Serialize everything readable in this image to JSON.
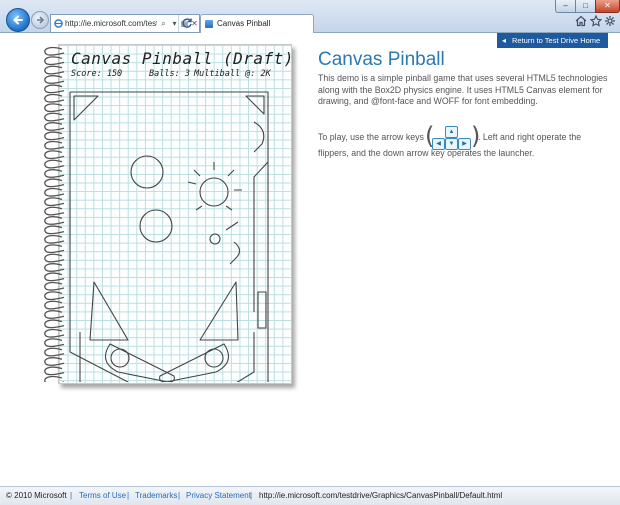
{
  "browser": {
    "address_url": "http://ie.microsoft.com/testdri",
    "tab_title": "Canvas Pinball",
    "colors": {
      "accent": "#1e5b9e",
      "heading": "#2a7ab0"
    }
  },
  "page": {
    "return_button": "Return to Test Drive Home",
    "heading": "Canvas Pinball",
    "description": "This demo is a simple pinball game that uses several HTML5 technologies along with the Box2D physics engine. It uses HTML5 Canvas element for drawing, and @font-face and WOFF for font embedding.",
    "play_text_before": "To play, use the arrow keys",
    "play_text_after": ". Left and right operate the",
    "play_text_line2": "flippers, and the down arrow key operates the launcher."
  },
  "game": {
    "title": "Canvas Pinball (Draft)",
    "score_label": "Score: 150",
    "balls_label": "Balls: 3",
    "multiball_label": "Multiball @: 2K"
  },
  "footer": {
    "copyright": "© 2010 Microsoft",
    "links": [
      "Terms of Use",
      "Trademarks",
      "Privacy Statement"
    ],
    "status_url": "http://ie.microsoft.com/testdrive/Graphics/CanvasPinball/Default.html"
  }
}
